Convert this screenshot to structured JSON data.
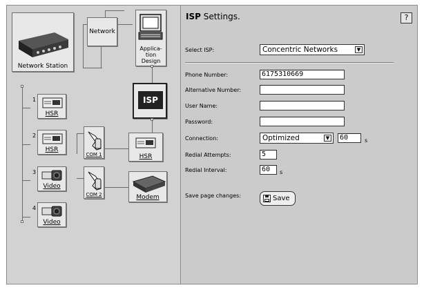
{
  "topology": {
    "network_station": "Network Station",
    "network": "Network",
    "application_design": [
      "Applica-",
      "tion",
      "Design"
    ],
    "isp": "ISP",
    "hsr": "HSR",
    "modem": "Modem",
    "video": "Video",
    "com1": "COM 1",
    "com2": "COM 2",
    "slots": [
      {
        "num": "1",
        "label": "HSR"
      },
      {
        "num": "2",
        "label": "HSR"
      },
      {
        "num": "3",
        "label": "Video"
      },
      {
        "num": "4",
        "label": "Video"
      }
    ]
  },
  "settings": {
    "title_bold": "ISP",
    "title_rest": " Settings.",
    "help": "?",
    "select_isp_label": "Select ISP:",
    "select_isp_value": "Concentric Networks",
    "phone_label": "Phone Number:",
    "phone_value": "6175310669",
    "alt_label": "Alternative Number:",
    "alt_value": "",
    "user_label": "User Name:",
    "user_value": "",
    "password_label": "Password:",
    "password_value": "",
    "connection_label": "Connection:",
    "connection_value": "Optimized",
    "connection_seconds": "60",
    "seconds_unit": "s",
    "redial_attempts_label": "Redial Attempts:",
    "redial_attempts_value": "5",
    "redial_interval_label": "Redial Interval:",
    "redial_interval_value": "60",
    "save_changes_label": "Save page changes:",
    "save_button": "Save"
  }
}
